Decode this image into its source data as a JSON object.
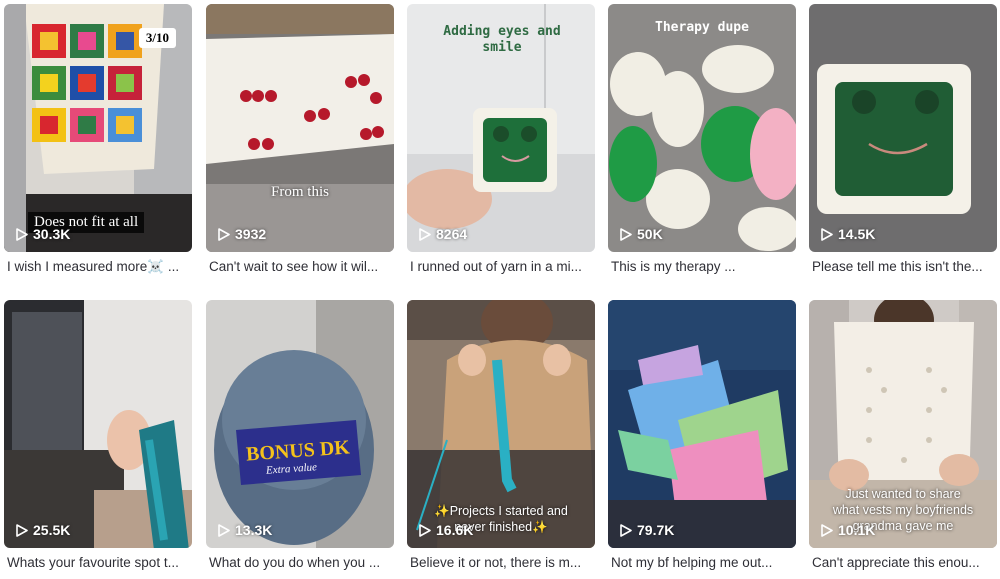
{
  "videos": [
    {
      "views": "30.3K",
      "caption": "I wish I measured more☠️ ...",
      "overlay": "Does not fit at all",
      "badge": "3/10"
    },
    {
      "views": "3932",
      "caption": "Can't wait to see how it wil...",
      "overlay": "From this"
    },
    {
      "views": "8264",
      "caption": "I runned out of yarn in a mi...",
      "overlay": "Adding eyes and smile"
    },
    {
      "views": "50K",
      "caption": "This is my therapy ...",
      "overlay": "Therapy dupe"
    },
    {
      "views": "14.5K",
      "caption": "Please tell me this isn't the..."
    },
    {
      "views": "25.5K",
      "caption": "Whats your favourite spot t..."
    },
    {
      "views": "13.3K",
      "caption": "What do you do when you ...",
      "overlay": "BONUS DK",
      "overlay2": "Extra value"
    },
    {
      "views": "16.6K",
      "caption": "Believe it or not, there is m...",
      "overlay": "✨Projects I started and",
      "overlay2": "never finished✨"
    },
    {
      "views": "79.7K",
      "caption": "Not my bf helping me out..."
    },
    {
      "views": "10.1K",
      "caption": "Can't appreciate this enou...",
      "overlay": "Just wanted to share",
      "overlay2": "what vests my boyfriends",
      "overlay3": "grandma gave me"
    }
  ],
  "icons": {
    "play": "play-icon"
  },
  "colors": {
    "text": "#161823",
    "caption": "#2f2f36",
    "overlay_text": "#ffffff"
  }
}
